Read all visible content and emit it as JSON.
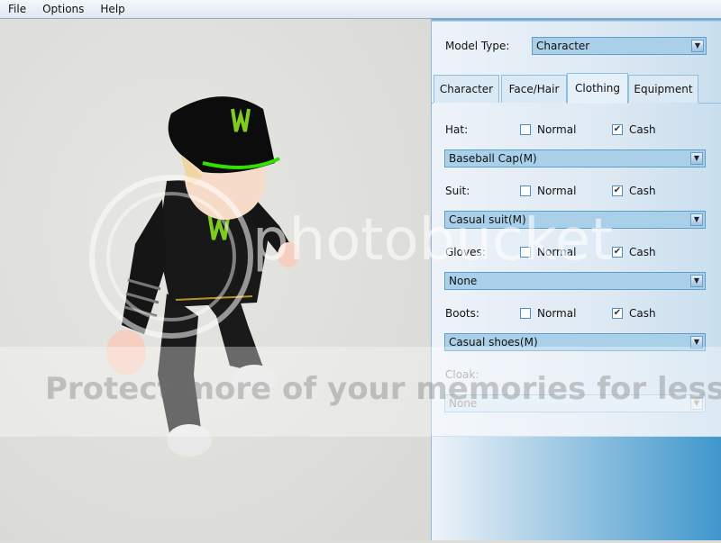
{
  "menubar": {
    "items": [
      "File",
      "Options",
      "Help"
    ]
  },
  "panel": {
    "model_type_label": "Model Type:",
    "model_type_value": "Character",
    "tabs": [
      {
        "label": "Character"
      },
      {
        "label": "Face/Hair"
      },
      {
        "label": "Clothing",
        "active": true
      },
      {
        "label": "Equipment"
      }
    ],
    "slots": [
      {
        "label": "Hat:",
        "normal_label": "Normal",
        "normal_checked": false,
        "cash_label": "Cash",
        "cash_checked": true,
        "value": "Baseball Cap(M)",
        "enabled": true
      },
      {
        "label": "Suit:",
        "normal_label": "Normal",
        "normal_checked": false,
        "cash_label": "Cash",
        "cash_checked": true,
        "value": "Casual suit(M)",
        "enabled": true
      },
      {
        "label": "Gloves:",
        "normal_label": "Normal",
        "normal_checked": false,
        "cash_label": "Cash",
        "cash_checked": true,
        "value": "None",
        "enabled": true
      },
      {
        "label": "Boots:",
        "normal_label": "Normal",
        "normal_checked": false,
        "cash_label": "Cash",
        "cash_checked": true,
        "value": "Casual shoes(M)",
        "enabled": true
      },
      {
        "label": "Cloak:",
        "value": "None",
        "enabled": false
      }
    ]
  },
  "watermark": {
    "logo": "photobucket",
    "tagline": "Protect more of your memories for less!"
  },
  "colors": {
    "accent": "#4a9fd2",
    "combo_bg": "#a9d0e8",
    "viewport_bg": "#dcdcd8"
  }
}
